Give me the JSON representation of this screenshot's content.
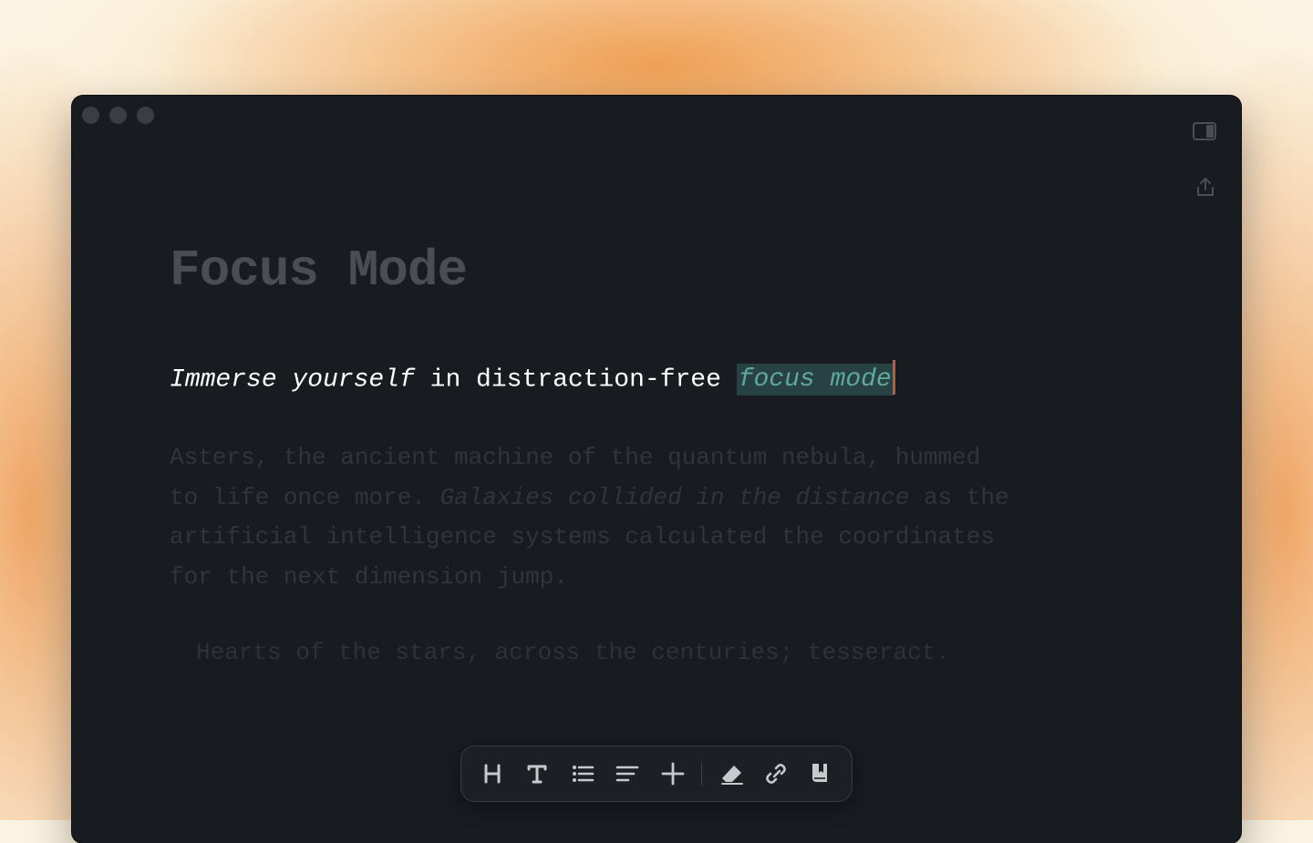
{
  "document": {
    "title": "Focus Mode",
    "active_line": {
      "italic_part": "Immerse yourself",
      "plain_part": " in distraction-free ",
      "highlighted": "focus mode"
    },
    "paragraph": {
      "line1": "Asters, the ancient machine of the quantum nebula, hummed",
      "line2_start": "to life once more. ",
      "line2_italic": "Galaxies collided in the distance",
      "line2_end": " as the",
      "line3": "artificial intelligence systems calculated the coordinates",
      "line4": "for the next dimension jump."
    },
    "quote": "Hearts of the stars, across the centuries; tesseract."
  },
  "window_controls": {
    "buttons": [
      "close",
      "minimize",
      "zoom"
    ]
  },
  "topbar_icons": [
    "sidebar-toggle-icon",
    "share-icon"
  ],
  "toolbar": {
    "buttons": [
      {
        "name": "heading-icon",
        "label": "H"
      },
      {
        "name": "text-icon",
        "label": "T"
      },
      {
        "name": "list-icon"
      },
      {
        "name": "align-icon"
      },
      {
        "name": "plus-icon"
      },
      {
        "name": "eraser-icon"
      },
      {
        "name": "link-icon"
      },
      {
        "name": "bookmark-icon"
      }
    ]
  },
  "colors": {
    "background": "#fbf3e1",
    "glow": "#ee9646",
    "window": "#181c21",
    "title": "#4a4e54",
    "active_text": "#ffffff",
    "highlight_bg": "#284244",
    "highlight_text": "#5fa89a",
    "cursor": "#c3583f",
    "dimmed_text": "#30353b"
  }
}
